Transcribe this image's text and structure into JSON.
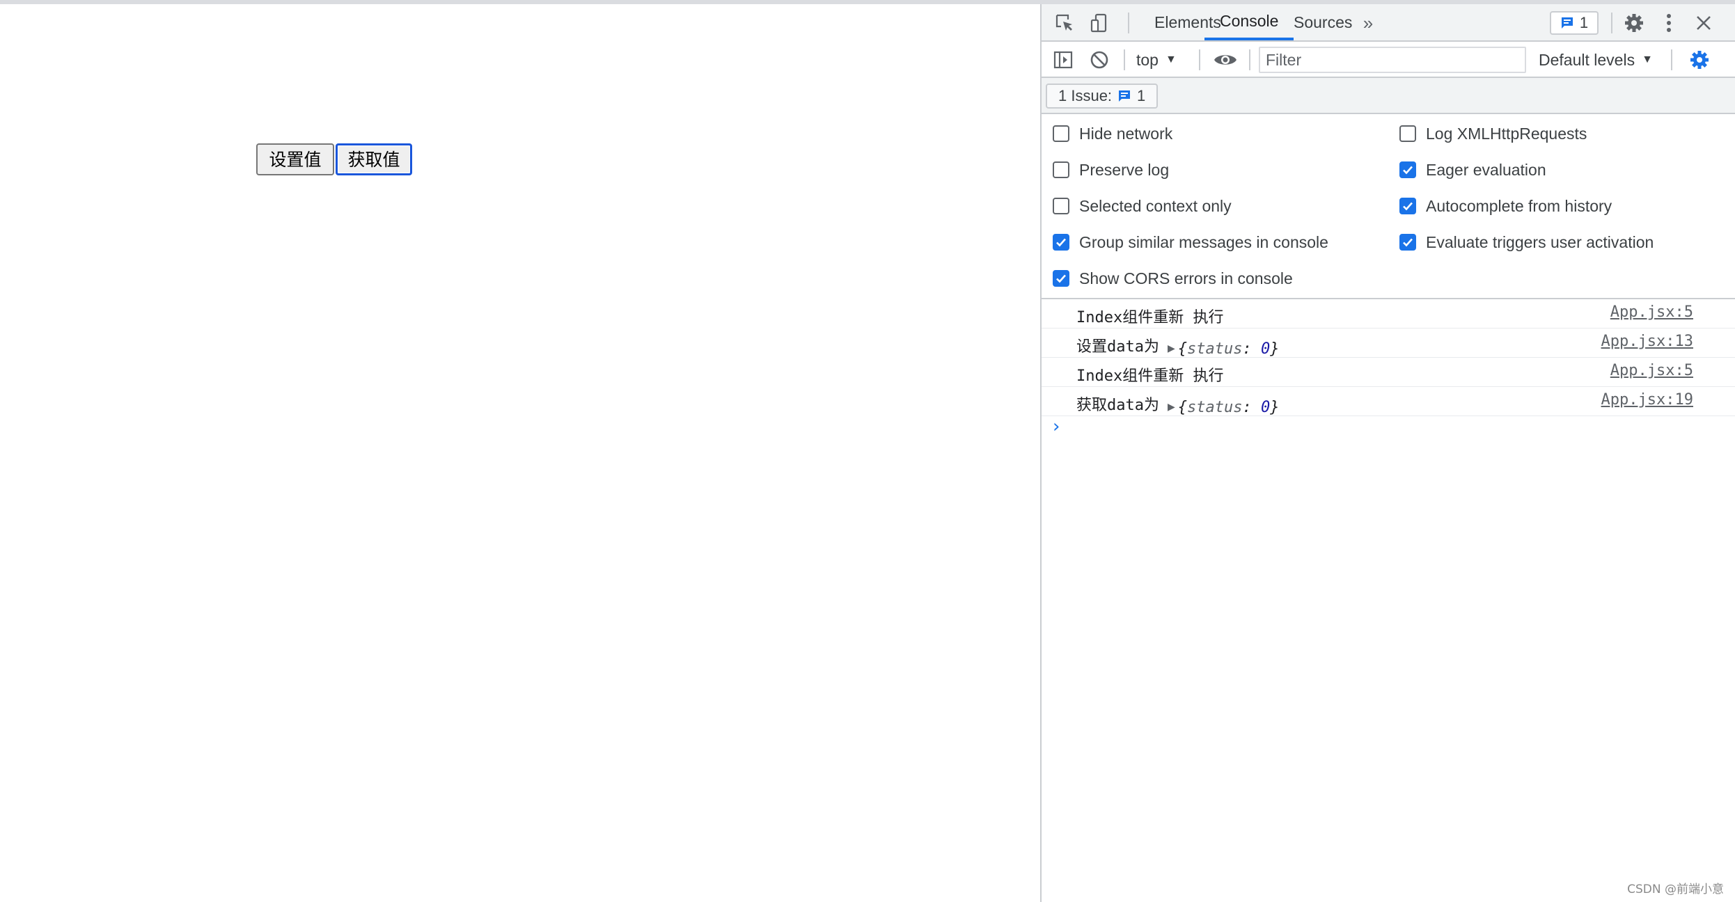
{
  "page": {
    "buttons": {
      "set_label": "设置值",
      "get_label": "获取值"
    }
  },
  "devtools": {
    "tabs": [
      {
        "label": "Elements"
      },
      {
        "label": "Console"
      },
      {
        "label": "Sources"
      }
    ],
    "active_tab": "Console",
    "more_tabs_icon": "double-chevron-right-icon",
    "issues_count": "1",
    "toolbar": {
      "context": "top",
      "filter_placeholder": "Filter",
      "levels": "Default levels"
    },
    "issuebar": {
      "label": "1 Issue:",
      "count": "1"
    },
    "settings": [
      {
        "label": "Hide network",
        "checked": false
      },
      {
        "label": "Preserve log",
        "checked": false
      },
      {
        "label": "Selected context only",
        "checked": false
      },
      {
        "label": "Group similar messages in console",
        "checked": true
      },
      {
        "label": "Show CORS errors in console",
        "checked": true
      },
      {
        "label": "Log XMLHttpRequests",
        "checked": false
      },
      {
        "label": "Eager evaluation",
        "checked": true
      },
      {
        "label": "Autocomplete from history",
        "checked": true
      },
      {
        "label": "Evaluate triggers user activation",
        "checked": true
      }
    ],
    "messages": [
      {
        "text": "Index组件重新 执行",
        "source": "App.jsx:5"
      },
      {
        "text": "设置data为",
        "object_key": "status",
        "object_value": "0",
        "source": "App.jsx:13"
      },
      {
        "text": "Index组件重新 执行",
        "source": "App.jsx:5"
      },
      {
        "text": "获取data为",
        "object_key": "status",
        "object_value": "0",
        "source": "App.jsx:19"
      }
    ],
    "prompt_symbol": "›"
  },
  "watermark": "CSDN @前端小意",
  "colors": {
    "accent": "#1a73e8",
    "focus_border": "#1a56db",
    "object_value": "#1a1aa6"
  }
}
